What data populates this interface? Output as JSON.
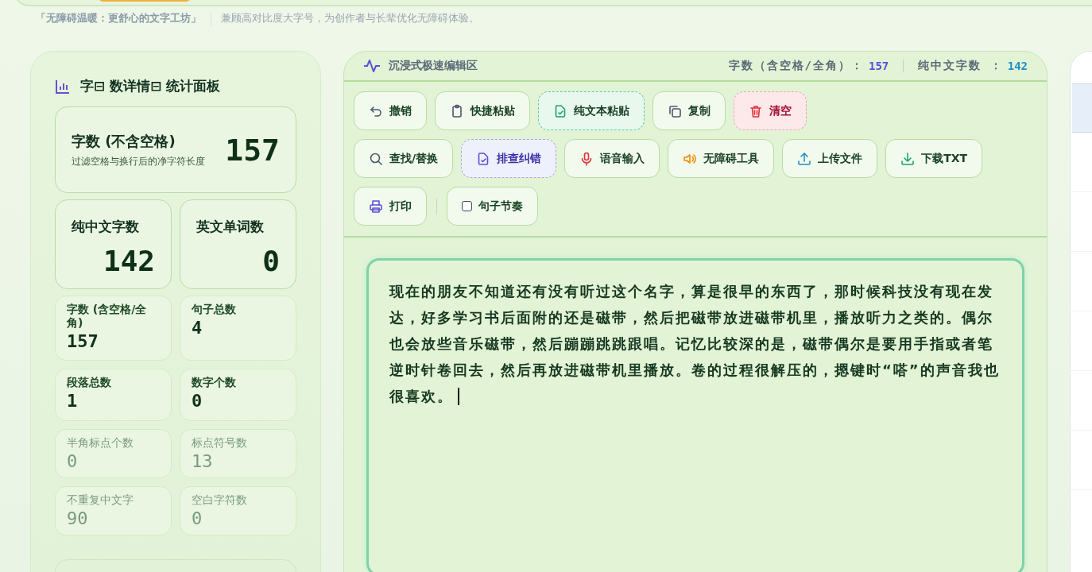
{
  "header": {
    "tagline": "「无障碍温暖：更舒心的文字工坊」",
    "subtitle": "兼顾高对比度大字号，为创作者与长辈优化无障碍体验。"
  },
  "stats_panel": {
    "title": "字⊟ 数详情⊟ 统计面板",
    "main_card": {
      "label": "字数 (不含空格)",
      "description": "过滤空格与换行后的净字符长度",
      "value": "157"
    },
    "big_cards": [
      {
        "label": "纯中文字数",
        "value": "142"
      },
      {
        "label": "英文单词数",
        "value": "0"
      }
    ],
    "small_cards": [
      {
        "label": "字数 (含空格/全角)",
        "value": "157",
        "kind": "strong"
      },
      {
        "label": "句子总数",
        "value": "4",
        "kind": "strong"
      },
      {
        "label": "段落总数",
        "value": "1",
        "kind": "strong"
      },
      {
        "label": "数字个数",
        "value": "0",
        "kind": "strong"
      },
      {
        "label": "半角标点个数",
        "value": "0",
        "kind": "faint"
      },
      {
        "label": "标点符号数",
        "value": "13",
        "kind": "faint"
      },
      {
        "label": "不重复中文字",
        "value": "90",
        "kind": "faint"
      },
      {
        "label": "空白字符数",
        "value": "0",
        "kind": "faint"
      }
    ]
  },
  "editor": {
    "title": "沉浸式极速编辑区",
    "counts": [
      {
        "label": "字数（含空格/全角）：",
        "value": "157",
        "color": "#5b4fd6"
      },
      {
        "label": "纯中文字数 ：",
        "value": "142",
        "color": "#1f8fc4"
      }
    ],
    "toolbar_rows": [
      [
        {
          "label": "撤销",
          "kind": "plain"
        },
        {
          "label": "快捷粘贴",
          "kind": "plain"
        },
        {
          "label": "纯文本粘贴",
          "kind": "dashed-green"
        },
        {
          "label": "复制",
          "kind": "plain"
        },
        {
          "label": "清空",
          "kind": "danger"
        }
      ],
      [
        {
          "label": "查找/替换",
          "kind": "plain"
        },
        {
          "label": "排查纠错",
          "kind": "dashed-purple"
        },
        {
          "label": "语音输入",
          "kind": "plain"
        },
        {
          "label": "无障碍工具",
          "kind": "plain"
        },
        {
          "label": "上传文件",
          "kind": "plain"
        },
        {
          "label": "下载TXT",
          "kind": "plain"
        }
      ],
      [
        {
          "label": "打印",
          "kind": "plain"
        },
        {
          "label": "句子节奏",
          "kind": "checkbox",
          "checked": false
        }
      ]
    ],
    "text": "现在的朋友不知道还有没有听过这个名字，算是很早的东西了，那时候科技没有现在发达，好多学习书后面附的还是磁带，然后把磁带放进磁带机里，播放听力之类的。偶尔也会放些音乐磁带，然后蹦蹦跳跳跟唱。记忆比较深的是，磁带偶尔是要用手指或者笔逆时针卷回去，然后再放进磁带机里播放。卷的过程很解压的，摁键时“嗒”的声音我也很喜欢。"
  }
}
